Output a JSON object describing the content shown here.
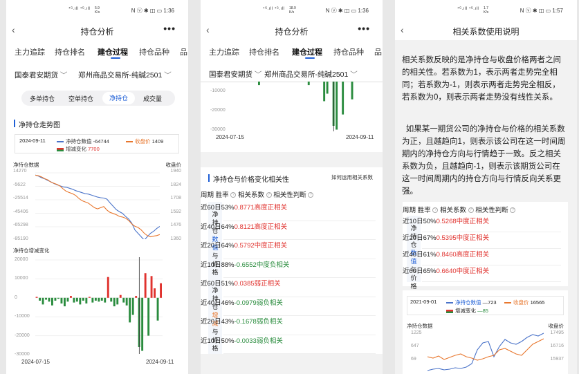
{
  "screen1": {
    "status": {
      "signal": "⁴ᴳ.ıll ⁴ᴳ.ıll",
      "speed": "5.9 K/s",
      "icons": "N ⓥ ✱ ◫ ▭",
      "time": "1:36"
    },
    "nav": {
      "title": "持仓分析",
      "more": "•••"
    },
    "tabs": [
      "主力追踪",
      "持仓排名",
      "建仓过程",
      "持仓品种",
      "品"
    ],
    "broker": "国泰君安期货",
    "exchange": "郑州商品交易所-纯碱2501",
    "segments": [
      "多单持仓",
      "空单持仓",
      "净持仓",
      "成交量"
    ],
    "section_title": "净持仓走势图",
    "legend": {
      "date": "2024-09-11",
      "net_label": "净持仓数值",
      "net_value": "-64744",
      "close_label": "收盘价",
      "close_value": "1409",
      "chg_label": "增减变化",
      "chg_value": "7700"
    },
    "chart1": {
      "left_title": "净持仓数据",
      "right_title": "收盘价",
      "left_ticks": [
        "14270",
        "-5622",
        "-25514",
        "-45406",
        "-65298",
        "-85190"
      ],
      "right_ticks": [
        "1940",
        "1824",
        "1708",
        "1592",
        "1476",
        "1360"
      ]
    },
    "chart2": {
      "title": "净持仓增减变化",
      "ticks": [
        "20000",
        "10000",
        "0",
        "-10000",
        "-20000",
        "-30000"
      ],
      "x_start": "2024-07-15",
      "x_end": "2024-09-11"
    }
  },
  "screen2": {
    "status": {
      "signal": "⁴ᴳ.ıll ⁴ᴳ.ıll",
      "speed": "18.9 K/s",
      "icons": "N ⓥ ✱ ◫ ▭",
      "time": "1:36"
    },
    "nav": {
      "title": "持仓分析",
      "more": "•••"
    },
    "tabs": [
      "主力追踪",
      "持仓排名",
      "建仓过程",
      "持仓品种",
      "品"
    ],
    "broker": "国泰君安期货",
    "exchange": "郑州商品交易所-纯碱2501",
    "chart": {
      "ticks": [
        "-10000",
        "-20000",
        "-30000"
      ],
      "x_start": "2024-07-15",
      "x_end": "2024-09-11"
    },
    "section_title": "净持仓与价格变化相关性",
    "help_link": "如何运用相关系数",
    "headers": [
      "周期",
      "胜率",
      "相关系数",
      "相关性判断"
    ],
    "group1": "净持仓数值与价格",
    "group2": "净持仓增减与价格",
    "rows1": [
      {
        "period": "近60日",
        "win": "53%",
        "coef": "0.8771",
        "judge": "高度正相关",
        "c": "red"
      },
      {
        "period": "近40日",
        "win": "64%",
        "coef": "0.8121",
        "judge": "高度正相关",
        "c": "red"
      },
      {
        "period": "近20日",
        "win": "64%",
        "coef": "0.5792",
        "judge": "中度正相关",
        "c": "red"
      },
      {
        "period": "近10日",
        "win": "88%",
        "coef": "-0.6552",
        "judge": "中度负相关",
        "c": "green"
      }
    ],
    "rows2": [
      {
        "period": "近60日",
        "win": "51%",
        "coef": "0.0385",
        "judge": "弱正相关",
        "c": "red"
      },
      {
        "period": "近40日",
        "win": "46%",
        "coef": "-0.0979",
        "judge": "弱负相关",
        "c": "green"
      },
      {
        "period": "近20日",
        "win": "43%",
        "coef": "-0.1678",
        "judge": "弱负相关",
        "c": "green"
      },
      {
        "period": "近10日",
        "win": "50%",
        "coef": "-0.0033",
        "judge": "弱负相关",
        "c": "green"
      }
    ]
  },
  "screen3": {
    "status": {
      "signal": "⁴ᴳ.ıll ⁴ᴳ.ıll",
      "speed": "1.7 K/s",
      "icons": "N ⓥ ✱ ◫ ▭",
      "time": "1:57"
    },
    "nav": {
      "title": "相关系数使用说明"
    },
    "para1": "相关系数反映的是净持仓与收盘价格两者之间的相关性。若系数为1，表示两者走势完全相同；若系数为-1，则表示两者走势完全相反，若系数为0，则表示两者走势没有线性关系。",
    "para2": "如果某一期货公司的净持仓与价格的相关系数为正，且越趋向1，则表示该公司在这一时间周期内的净持仓方向与行情趋于一致。反之相关系数为负，且越趋向-1，则表示该期货公司在这一时间周期内的持仓方向与行情反向关系更强。",
    "headers": [
      "周期",
      "胜率",
      "相关系数",
      "相关性判断"
    ],
    "group": "净持仓数值与价格",
    "rows": [
      {
        "period": "近10日",
        "win": "50%",
        "coef": "0.5268",
        "judge": "中度正相关"
      },
      {
        "period": "近20日",
        "win": "67%",
        "coef": "0.5395",
        "judge": "中度正相关"
      },
      {
        "period": "近40日",
        "win": "61%",
        "coef": "0.8460",
        "judge": "高度正相关"
      },
      {
        "period": "近60日",
        "win": "65%",
        "coef": "0.6640",
        "judge": "中度正相关"
      }
    ],
    "legend": {
      "date": "2021-09-01",
      "net_label": "净持仓数值",
      "net_value": "—723",
      "close_label": "收盘价",
      "close_value": "16565",
      "chg_label": "增减变化",
      "chg_value": "—85"
    },
    "chart": {
      "left_title": "净持仓数据",
      "right_title": "收盘价",
      "left_ticks": [
        "1225",
        "647",
        "69"
      ],
      "right_ticks": [
        "17495",
        "16716",
        "15937"
      ]
    }
  },
  "colors": {
    "blue": "#1f5fd6",
    "net_line": "#4a73c9",
    "close_line": "#e8772e",
    "up": "#e0322e",
    "down": "#2a8c3e"
  },
  "chart_data": [
    {
      "type": "line",
      "title": "净持仓走势图",
      "x": [
        "2024-07-15",
        "",
        "",
        "",
        "",
        "",
        "",
        "",
        "",
        "",
        "",
        "",
        "",
        "",
        "",
        "",
        "",
        "",
        "",
        "",
        "",
        "",
        "",
        "",
        "",
        "",
        "",
        "",
        "",
        "",
        "",
        "",
        "",
        "",
        "",
        "",
        "",
        "",
        "",
        "",
        "2024-09-11"
      ],
      "series": [
        {
          "name": "净持仓数值",
          "axis": "left",
          "values": [
            11000,
            9500,
            7000,
            5500,
            3000,
            1000,
            -1500,
            -3500,
            -5000,
            -6500,
            -7000,
            -8500,
            -10000,
            -12000,
            -13500,
            -15000,
            -16500,
            -17000,
            -18500,
            -20000,
            -21500,
            -22500,
            -23000,
            -24500,
            -30000,
            -35000,
            -40000,
            -43000,
            -45500,
            -50000,
            -54000,
            -60000,
            -70000,
            -75000,
            -80000,
            -85000,
            -80000,
            -75000,
            -72000,
            -68000,
            -64744
          ]
        },
        {
          "name": "收盘价",
          "axis": "right",
          "values": [
            1920,
            1915,
            1905,
            1890,
            1880,
            1860,
            1850,
            1840,
            1825,
            1800,
            1780,
            1770,
            1760,
            1745,
            1720,
            1700,
            1690,
            1680,
            1660,
            1640,
            1630,
            1640,
            1650,
            1620,
            1600,
            1590,
            1580,
            1565,
            1560,
            1550,
            1530,
            1500,
            1480,
            1470,
            1450,
            1420,
            1400,
            1390,
            1395,
            1400,
            1409
          ]
        }
      ],
      "ylim_left": [
        -85190,
        14270
      ],
      "ylim_right": [
        1360,
        1940
      ]
    },
    {
      "type": "bar",
      "title": "净持仓增减变化",
      "x_start": "2024-07-15",
      "x_end": "2024-09-11",
      "values": [
        500,
        -1500,
        -3500,
        -1000,
        -2000,
        -4000,
        -1500,
        -500,
        -3000,
        -4500,
        -2000,
        1000,
        -2500,
        -2000,
        -3500,
        -1500,
        -3000,
        500,
        -2500,
        -1500,
        -2000,
        -1500,
        -2500,
        11000,
        -2000,
        -4500,
        -3500,
        1500,
        -2500,
        -4000,
        -13000,
        -9000,
        1000,
        -26000,
        -28000,
        13000,
        -20000,
        11500,
        5000,
        -12000,
        7700
      ],
      "ylim": [
        -30000,
        20000
      ]
    }
  ]
}
